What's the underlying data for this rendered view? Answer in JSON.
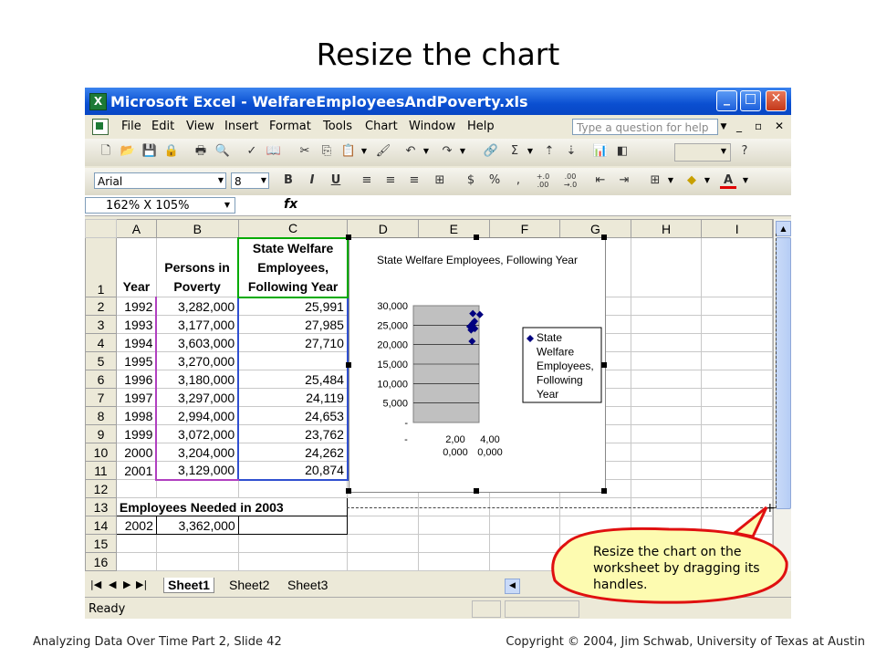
{
  "slide": {
    "title": "Resize the chart",
    "footer_left": "Analyzing Data Over Time Part 2, Slide 42",
    "footer_right": "Copyright © 2004, Jim Schwab, University of Texas at Austin"
  },
  "window": {
    "title": "Microsoft Excel - WelfareEmployeesAndPoverty.xls",
    "minimize": "_",
    "maximize": "□",
    "close": "✕"
  },
  "menu": {
    "items": [
      "File",
      "Edit",
      "View",
      "Insert",
      "Format",
      "Tools",
      "Chart",
      "Window",
      "Help"
    ],
    "ask_placeholder": "Type a question for help",
    "mdi_min": "_",
    "mdi_restore": "▫",
    "mdi_close": "✕"
  },
  "toolbar": {
    "font_name": "Arial",
    "font_size": "8",
    "bold": "B",
    "italic": "I",
    "underline": "U",
    "currency": "$",
    "percent": "%",
    "comma": ",",
    "inc_decimal": "+.0 .00",
    "dec_decimal": ".00 →.0",
    "sum": "Σ",
    "font_color": "A"
  },
  "formula_bar": {
    "name_box": "162% X 105%",
    "fx": "fx"
  },
  "sheet": {
    "columns": [
      "A",
      "B",
      "C",
      "D",
      "E",
      "F",
      "G",
      "H",
      "I"
    ],
    "header_row": {
      "num": "1",
      "a": "Year",
      "b": "Persons in Poverty",
      "c": "State Welfare Employees, Following Year"
    },
    "rows": [
      {
        "num": "2",
        "a": "1992",
        "b": "3,282,000",
        "c": "25,991"
      },
      {
        "num": "3",
        "a": "1993",
        "b": "3,177,000",
        "c": "27,985"
      },
      {
        "num": "4",
        "a": "1994",
        "b": "3,603,000",
        "c": "27,710"
      },
      {
        "num": "5",
        "a": "1995",
        "b": "3,270,000",
        "c": ""
      },
      {
        "num": "6",
        "a": "1996",
        "b": "3,180,000",
        "c": "25,484"
      },
      {
        "num": "7",
        "a": "1997",
        "b": "3,297,000",
        "c": "24,119"
      },
      {
        "num": "8",
        "a": "1998",
        "b": "2,994,000",
        "c": "24,653"
      },
      {
        "num": "9",
        "a": "1999",
        "b": "3,072,000",
        "c": "23,762"
      },
      {
        "num": "10",
        "a": "2000",
        "b": "3,204,000",
        "c": "24,262"
      },
      {
        "num": "11",
        "a": "2001",
        "b": "3,129,000",
        "c": "20,874"
      }
    ],
    "row12": "12",
    "row13": {
      "num": "13",
      "text": "Employees Needed in 2003"
    },
    "row14": {
      "num": "14",
      "a": "2002",
      "b": "3,362,000"
    },
    "row15": "15",
    "row16": "16"
  },
  "tabs": {
    "sheets": [
      "Sheet1",
      "Sheet2",
      "Sheet3"
    ]
  },
  "status": {
    "text": "Ready"
  },
  "callout": {
    "text": "Resize the chart on the worksheet by dragging its handles."
  },
  "colors": {
    "title_bar": "#0a4fd1",
    "plot_area": "#c0c0c0",
    "marker": "#000080",
    "callout_fill": "#fdfbb0",
    "callout_border": "#e01010"
  },
  "chart_data": {
    "type": "scatter",
    "title": "State Welfare Employees, Following Year",
    "series": [
      {
        "name": "State Welfare Employees, Following Year",
        "x": [
          3282000,
          3177000,
          3603000,
          3180000,
          3297000,
          2994000,
          3072000,
          3204000,
          3129000
        ],
        "y": [
          25991,
          27985,
          27710,
          25484,
          24119,
          24653,
          23762,
          24262,
          20874
        ]
      }
    ],
    "y_ticks": [
      "30,000",
      "25,000",
      "20,000",
      "15,000",
      "10,000",
      "5,000",
      "-"
    ],
    "x_ticks": [
      "-",
      "2,00\n0,000",
      "4,00\n0,000"
    ],
    "ylim": [
      0,
      30000
    ],
    "xlim": [
      0,
      4000000
    ],
    "legend": {
      "position": "right",
      "text": "State Welfare Employees, Following Year"
    },
    "grid": true
  }
}
